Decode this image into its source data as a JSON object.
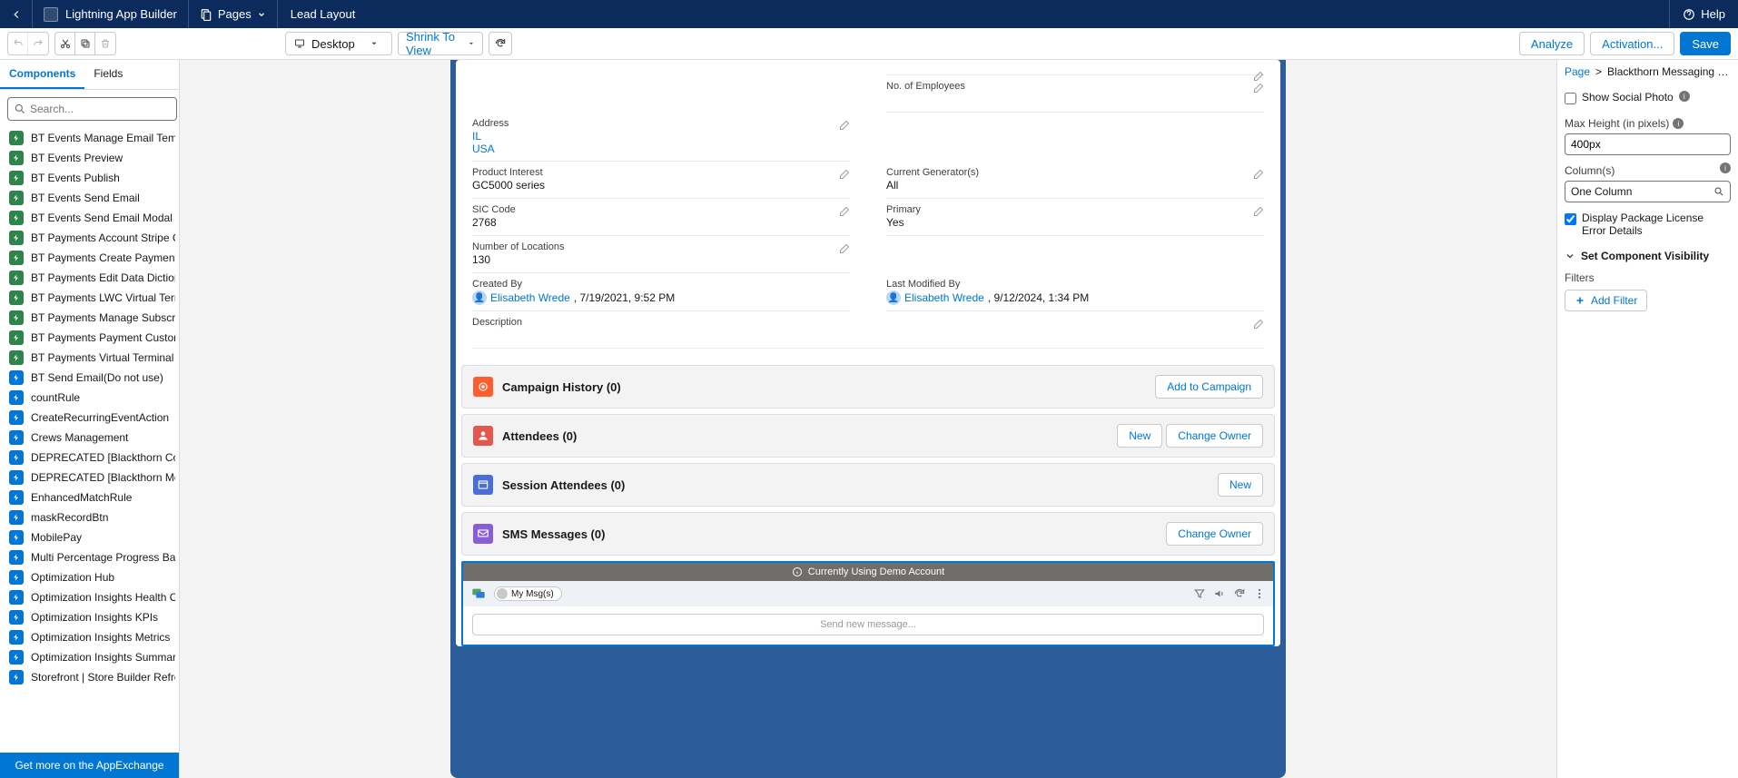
{
  "header": {
    "app_name": "Lightning App Builder",
    "pages_label": "Pages",
    "layout_title": "Lead Layout",
    "help_label": "Help"
  },
  "toolbar": {
    "device": "Desktop",
    "zoom": "Shrink To View",
    "analyze": "Analyze",
    "activation": "Activation...",
    "save": "Save"
  },
  "left": {
    "tabs": {
      "components": "Components",
      "fields": "Fields"
    },
    "search_placeholder": "Search...",
    "items": [
      {
        "label": "BT Events Manage Email Template",
        "color": "green"
      },
      {
        "label": "BT Events Preview",
        "color": "green"
      },
      {
        "label": "BT Events Publish",
        "color": "green"
      },
      {
        "label": "BT Events Send Email",
        "color": "green"
      },
      {
        "label": "BT Events Send Email Modal",
        "color": "green"
      },
      {
        "label": "BT Payments Account Stripe Cus...",
        "color": "green"
      },
      {
        "label": "BT Payments Create Payment M...",
        "color": "green"
      },
      {
        "label": "BT Payments Edit Data Dictionary",
        "color": "green"
      },
      {
        "label": "BT Payments LWC Virtual Terminal",
        "color": "green"
      },
      {
        "label": "BT Payments Manage Subscripti...",
        "color": "green"
      },
      {
        "label": "BT Payments Payment Customer...",
        "color": "green"
      },
      {
        "label": "BT Payments Virtual Terminal",
        "color": "green"
      },
      {
        "label": "BT Send Email(Do not use)",
        "color": "blue"
      },
      {
        "label": "countRule",
        "color": "blue"
      },
      {
        "label": "CreateRecurringEventAction",
        "color": "blue"
      },
      {
        "label": "Crews Management",
        "color": "blue"
      },
      {
        "label": "DEPRECATED [Blackthorn Conve...",
        "color": "blue"
      },
      {
        "label": "DEPRECATED [Blackthorn Messa...",
        "color": "blue"
      },
      {
        "label": "EnhancedMatchRule",
        "color": "blue"
      },
      {
        "label": "maskRecordBtn",
        "color": "blue"
      },
      {
        "label": "MobilePay",
        "color": "blue"
      },
      {
        "label": "Multi Percentage Progress Bar",
        "color": "blue"
      },
      {
        "label": "Optimization Hub",
        "color": "blue"
      },
      {
        "label": "Optimization Insights Health Che...",
        "color": "blue"
      },
      {
        "label": "Optimization Insights KPIs",
        "color": "blue"
      },
      {
        "label": "Optimization Insights Metrics",
        "color": "blue"
      },
      {
        "label": "Optimization Insights Summary",
        "color": "blue"
      },
      {
        "label": "Storefront | Store Builder Refres...",
        "color": "blue"
      }
    ],
    "appexchange": "Get more on the AppExchange"
  },
  "details": {
    "no_employees": {
      "label": "No. of Employees",
      "value": ""
    },
    "address": {
      "label": "Address",
      "state": "IL",
      "country": "USA"
    },
    "product_interest": {
      "label": "Product Interest",
      "value": "GC5000 series"
    },
    "current_gen": {
      "label": "Current Generator(s)",
      "value": "All"
    },
    "sic_code": {
      "label": "SIC Code",
      "value": "2768"
    },
    "primary": {
      "label": "Primary",
      "value": "Yes"
    },
    "num_locations": {
      "label": "Number of Locations",
      "value": "130"
    },
    "created_by": {
      "label": "Created By",
      "user": "Elisabeth Wrede",
      "date": ", 7/19/2021, 9:52 PM"
    },
    "last_modified": {
      "label": "Last Modified By",
      "user": "Elisabeth Wrede",
      "date": ", 9/12/2024, 1:34 PM"
    },
    "description": {
      "label": "Description",
      "value": ""
    }
  },
  "related": {
    "campaign": {
      "title": "Campaign History (0)",
      "add": "Add to Campaign",
      "color": "#ff5d2d"
    },
    "attendees": {
      "title": "Attendees (0)",
      "new": "New",
      "change": "Change Owner",
      "color": "#e2584f"
    },
    "session": {
      "title": "Session Attendees (0)",
      "new": "New",
      "color": "#4a6ed9"
    },
    "sms": {
      "title": "SMS Messages (0)",
      "change": "Change Owner",
      "color": "#8a5ed6"
    }
  },
  "widget": {
    "demo_bar": "Currently Using Demo Account",
    "my_msgs": "My Msg(s)",
    "send_placeholder": "Send new message..."
  },
  "right": {
    "crumb_page": "Page",
    "crumb_current": "Blackthorn Messaging Mes...",
    "show_social": "Show Social Photo",
    "max_height_label": "Max Height (in pixels)",
    "max_height_value": "400px",
    "columns_label": "Column(s)",
    "columns_value": "One Column",
    "display_pkg": "Display Package License Error Details",
    "visibility": "Set Component Visibility",
    "filters": "Filters",
    "add_filter": "Add Filter"
  }
}
